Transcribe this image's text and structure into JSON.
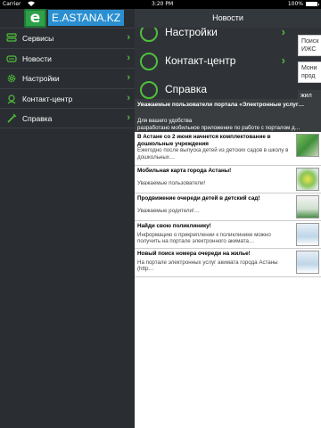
{
  "status_bar": {
    "carrier": "Carrier",
    "time": "3:20 PM",
    "battery_pct": "100%",
    "battery_level": 1.0
  },
  "sidebar": {
    "logo_letter": "e",
    "logo_text": "E.ASTANA.KZ",
    "items": [
      {
        "label": "Сервисы",
        "icon": "services-icon"
      },
      {
        "label": "Новости",
        "icon": "news-icon"
      },
      {
        "label": "Настройки",
        "icon": "gear-icon"
      },
      {
        "label": "Контакт-центр",
        "icon": "headset-icon"
      },
      {
        "label": "Справка",
        "icon": "help-icon"
      }
    ],
    "chevron": "›"
  },
  "panel": {
    "title": "Новости",
    "under_items": [
      {
        "label": "Настройки"
      },
      {
        "label": "Контакт-центр"
      },
      {
        "label": "Справка"
      }
    ],
    "peek_cards": [
      {
        "text": "Поиск ИЖС"
      },
      {
        "text": "Мони прод"
      },
      {
        "text": "жил"
      }
    ]
  },
  "news": {
    "highlight": {
      "title": "Уважаемые пользователи портала «Электронные услуг…",
      "desc_line1": "Для вашего удобства",
      "desc_line2": "разработано мобильное приложение по работе с порталом д…"
    },
    "items": [
      {
        "title": "В Астане со 2 июня начнется комплектование в дошкольные учреждения",
        "desc": "Ежегодно после выпуска детей из детских садов в школу в дошкольных…",
        "thumb": "kids"
      },
      {
        "title": "Мобильная карта города Астаны!",
        "desc": "Уважаемые пользователи!",
        "thumb": "map"
      },
      {
        "title": "Продвижение очереди детей в детский сад!",
        "desc": "Уважаемые родители!…",
        "thumb": "cert"
      },
      {
        "title": "Найди свою поликлинику!",
        "desc": "Информацию о прикреплении к поликлинике можно получить на портале электронного акимата…",
        "thumb": "doc"
      },
      {
        "title": "Новый поиск номера очереди на жилье!",
        "desc": "На портале электронных услуг акимата города Астаны (http…",
        "thumb": "doc"
      }
    ]
  },
  "colors": {
    "accent_green": "#4fbf3b",
    "logo_blue": "#2a8fd0",
    "sidebar_bg": "#2a2e32"
  }
}
